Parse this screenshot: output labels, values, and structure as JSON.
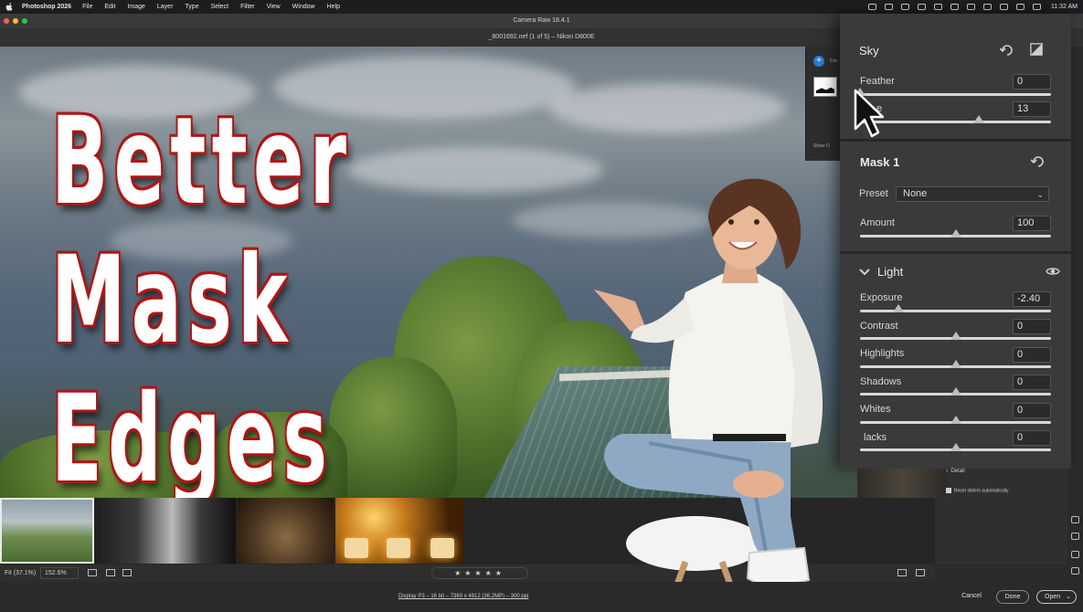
{
  "menubar": {
    "app_name": "Photoshop 2026",
    "items": [
      "File",
      "Edit",
      "Image",
      "Layer",
      "Type",
      "Select",
      "Filter",
      "View",
      "Window",
      "Help"
    ],
    "clock": "11:32 AM"
  },
  "window": {
    "title": "Camera Raw 18.4.1"
  },
  "document": {
    "label": "_8001692.nef (1 of 5)  –  Nikon D800E"
  },
  "headline": {
    "line1": "Better",
    "line2": "Mask",
    "line3": "Edges"
  },
  "mini_panel": {
    "create_label": "Cre",
    "show_label": "Show O"
  },
  "sky_section": {
    "title": "Sky",
    "feather_label": "Feather",
    "feather_value": "0",
    "feather_fraction": 0.0,
    "second_label": "e",
    "second_value": "13",
    "second_fraction": 0.62
  },
  "mask_section": {
    "title": "Mask 1",
    "preset_label": "Preset",
    "preset_value": "None",
    "amount_label": "Amount",
    "amount_value": "100",
    "amount_fraction": 0.5
  },
  "light_section": {
    "title": "Light",
    "sliders": [
      {
        "label": "Exposure",
        "value": "-2.40",
        "fraction": 0.2
      },
      {
        "label": "Contrast",
        "value": "0",
        "fraction": 0.5
      },
      {
        "label": "Highlights",
        "value": "0",
        "fraction": 0.5
      },
      {
        "label": "Shadows",
        "value": "0",
        "fraction": 0.5
      },
      {
        "label": "Whites",
        "value": "0",
        "fraction": 0.5
      },
      {
        "label": "lacks",
        "value": "0",
        "fraction": 0.5
      }
    ]
  },
  "lower_panel": {
    "detail_label": "Detail",
    "reset_label": "Reset sliders automatically"
  },
  "bottom_bar": {
    "fit_label": "Fit (37.1%)",
    "zoom_value": "152.6%",
    "stars": "★★★★★"
  },
  "footer": {
    "info": "Display P3 – 16 bit – 7360 x 4912 (36.2MP) – 300 ppi",
    "cancel": "Cancel",
    "done": "Done",
    "open": "Open"
  },
  "colors": {
    "accent": "#2d7ad6",
    "headline_outline": "#b01515",
    "panel_bg": "#3a3a3a"
  }
}
